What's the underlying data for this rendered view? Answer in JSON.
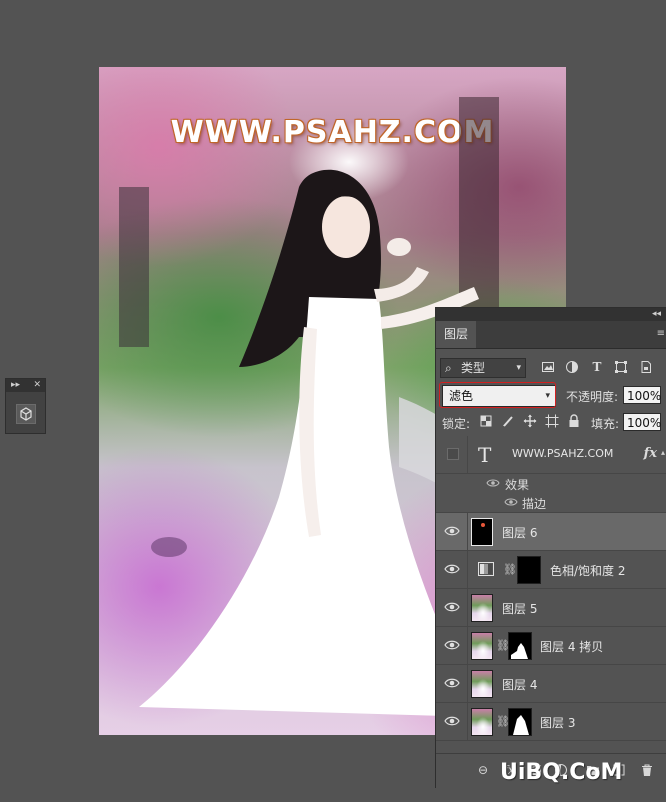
{
  "canvas": {
    "watermark_text": "WWW.PSAHZ.COM"
  },
  "mini_panel": {
    "expand_glyph": "▸▸",
    "close_glyph": "✕",
    "tool_icon": "3d-cube-icon"
  },
  "layers_panel": {
    "collapse_glyph": "◂◂",
    "tab_label": "图层",
    "menu_glyph": "≡",
    "filter": {
      "kind_label": "类型",
      "search_glyph": "⌕",
      "icons": [
        "image-filter-icon",
        "adjustment-filter-icon",
        "type-filter-icon",
        "shape-filter-icon",
        "smart-object-filter-icon"
      ]
    },
    "blend_mode": "滤色",
    "opacity_label": "不透明度:",
    "opacity_value": "100%",
    "lock_label": "锁定:",
    "fill_label": "填充:",
    "fill_value": "100%",
    "highlight_color": "#d32020"
  },
  "layers": [
    {
      "name": "WWW.PSAHZ.COM",
      "type": "text",
      "visible": false,
      "fx": "fx",
      "effects_label": "效果",
      "effects": [
        "描边"
      ]
    },
    {
      "name": "图层 6",
      "type": "pixel-black",
      "visible": true,
      "selected": true
    },
    {
      "name": "色相/饱和度 2",
      "type": "adjustment",
      "visible": true
    },
    {
      "name": "图层 5",
      "type": "pixel",
      "visible": true
    },
    {
      "name": "图层 4 拷贝",
      "type": "pixel-mask",
      "visible": true
    },
    {
      "name": "图层 4",
      "type": "pixel",
      "visible": true
    },
    {
      "name": "图层 3",
      "type": "pixel-mask",
      "visible": true
    }
  ],
  "footer": {
    "link_glyph": "⊖",
    "fx_label": "fx",
    "icons": [
      "link-layers-icon",
      "add-style-icon",
      "add-mask-icon",
      "new-adjustment-icon",
      "new-group-icon",
      "new-layer-icon",
      "delete-layer-icon"
    ]
  },
  "site_watermark": "UiBQ.CoM"
}
